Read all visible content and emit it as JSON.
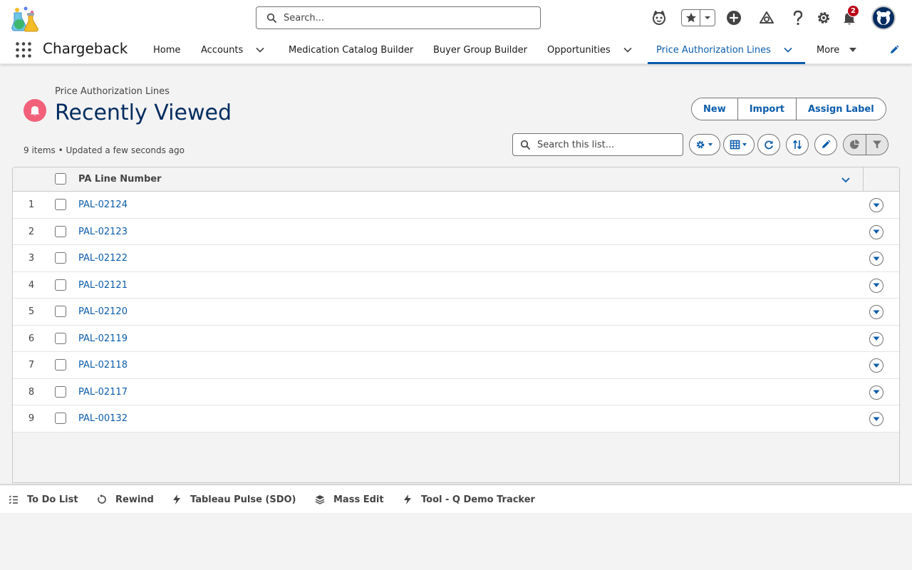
{
  "global_header": {
    "search_placeholder": "Search...",
    "notification_count": "2",
    "icons": [
      "logo-icon",
      "einstein-icon",
      "star-icon",
      "add-icon",
      "trailhead-icon",
      "help-icon",
      "gear-icon",
      "bell-icon",
      "avatar"
    ]
  },
  "navbar": {
    "app_name": "Chargeback",
    "items": [
      {
        "label": "Home"
      },
      {
        "label": "Accounts"
      },
      {
        "label": "Medication Catalog Builder"
      },
      {
        "label": "Buyer Group Builder"
      },
      {
        "label": "Opportunities"
      },
      {
        "label": "Price Authorization Lines"
      },
      {
        "label": "More"
      }
    ],
    "active_item": "Price Authorization Lines",
    "accent_color": "#0b5cab"
  },
  "list_view": {
    "object_label": "Price Authorization Lines",
    "title": "Recently Viewed",
    "meta": "9 items • Updated a few seconds ago",
    "actions": {
      "new": "New",
      "import": "Import",
      "assign_label": "Assign Label"
    },
    "search_placeholder": "Search this list...",
    "object_icon_color": "#f2607a"
  },
  "table": {
    "column_header": "PA Line Number",
    "rows": [
      {
        "num": "1",
        "value": "PAL-02124"
      },
      {
        "num": "2",
        "value": "PAL-02123"
      },
      {
        "num": "3",
        "value": "PAL-02122"
      },
      {
        "num": "4",
        "value": "PAL-02121"
      },
      {
        "num": "5",
        "value": "PAL-02120"
      },
      {
        "num": "6",
        "value": "PAL-02119"
      },
      {
        "num": "7",
        "value": "PAL-02118"
      },
      {
        "num": "8",
        "value": "PAL-02117"
      },
      {
        "num": "9",
        "value": "PAL-00132"
      }
    ]
  },
  "utility_bar": {
    "items": [
      {
        "label": "To Do List",
        "icon": "checklist-icon"
      },
      {
        "label": "Rewind",
        "icon": "rewind-icon"
      },
      {
        "label": "Tableau Pulse (SDO)",
        "icon": "bolt-icon"
      },
      {
        "label": "Mass Edit",
        "icon": "layers-icon"
      },
      {
        "label": "Tool - Q Demo Tracker",
        "icon": "bolt-icon"
      }
    ]
  }
}
